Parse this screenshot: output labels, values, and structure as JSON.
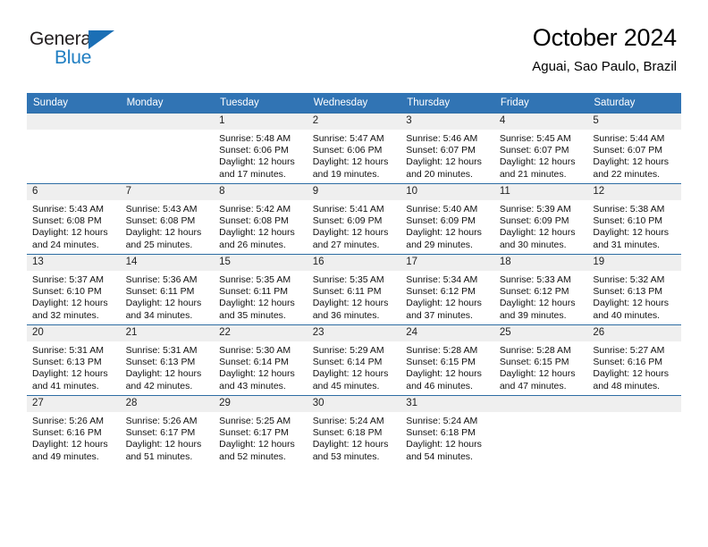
{
  "brand": {
    "name_part1": "General",
    "name_part2": "Blue",
    "flag_icon": "triangle-flag-icon"
  },
  "header": {
    "title": "October 2024",
    "subtitle": "Aguai, Sao Paulo, Brazil"
  },
  "colors": {
    "header_blue": "#3174b4",
    "row_border": "#2e6da4",
    "daynum_bg": "#efefef",
    "brand_blue": "#1f7ec2"
  },
  "weekday_headers": [
    "Sunday",
    "Monday",
    "Tuesday",
    "Wednesday",
    "Thursday",
    "Friday",
    "Saturday"
  ],
  "weeks": [
    [
      {
        "day": "",
        "lines": []
      },
      {
        "day": "",
        "lines": []
      },
      {
        "day": "1",
        "lines": [
          "Sunrise: 5:48 AM",
          "Sunset: 6:06 PM",
          "Daylight: 12 hours",
          "and 17 minutes."
        ]
      },
      {
        "day": "2",
        "lines": [
          "Sunrise: 5:47 AM",
          "Sunset: 6:06 PM",
          "Daylight: 12 hours",
          "and 19 minutes."
        ]
      },
      {
        "day": "3",
        "lines": [
          "Sunrise: 5:46 AM",
          "Sunset: 6:07 PM",
          "Daylight: 12 hours",
          "and 20 minutes."
        ]
      },
      {
        "day": "4",
        "lines": [
          "Sunrise: 5:45 AM",
          "Sunset: 6:07 PM",
          "Daylight: 12 hours",
          "and 21 minutes."
        ]
      },
      {
        "day": "5",
        "lines": [
          "Sunrise: 5:44 AM",
          "Sunset: 6:07 PM",
          "Daylight: 12 hours",
          "and 22 minutes."
        ]
      }
    ],
    [
      {
        "day": "6",
        "lines": [
          "Sunrise: 5:43 AM",
          "Sunset: 6:08 PM",
          "Daylight: 12 hours",
          "and 24 minutes."
        ]
      },
      {
        "day": "7",
        "lines": [
          "Sunrise: 5:43 AM",
          "Sunset: 6:08 PM",
          "Daylight: 12 hours",
          "and 25 minutes."
        ]
      },
      {
        "day": "8",
        "lines": [
          "Sunrise: 5:42 AM",
          "Sunset: 6:08 PM",
          "Daylight: 12 hours",
          "and 26 minutes."
        ]
      },
      {
        "day": "9",
        "lines": [
          "Sunrise: 5:41 AM",
          "Sunset: 6:09 PM",
          "Daylight: 12 hours",
          "and 27 minutes."
        ]
      },
      {
        "day": "10",
        "lines": [
          "Sunrise: 5:40 AM",
          "Sunset: 6:09 PM",
          "Daylight: 12 hours",
          "and 29 minutes."
        ]
      },
      {
        "day": "11",
        "lines": [
          "Sunrise: 5:39 AM",
          "Sunset: 6:09 PM",
          "Daylight: 12 hours",
          "and 30 minutes."
        ]
      },
      {
        "day": "12",
        "lines": [
          "Sunrise: 5:38 AM",
          "Sunset: 6:10 PM",
          "Daylight: 12 hours",
          "and 31 minutes."
        ]
      }
    ],
    [
      {
        "day": "13",
        "lines": [
          "Sunrise: 5:37 AM",
          "Sunset: 6:10 PM",
          "Daylight: 12 hours",
          "and 32 minutes."
        ]
      },
      {
        "day": "14",
        "lines": [
          "Sunrise: 5:36 AM",
          "Sunset: 6:11 PM",
          "Daylight: 12 hours",
          "and 34 minutes."
        ]
      },
      {
        "day": "15",
        "lines": [
          "Sunrise: 5:35 AM",
          "Sunset: 6:11 PM",
          "Daylight: 12 hours",
          "and 35 minutes."
        ]
      },
      {
        "day": "16",
        "lines": [
          "Sunrise: 5:35 AM",
          "Sunset: 6:11 PM",
          "Daylight: 12 hours",
          "and 36 minutes."
        ]
      },
      {
        "day": "17",
        "lines": [
          "Sunrise: 5:34 AM",
          "Sunset: 6:12 PM",
          "Daylight: 12 hours",
          "and 37 minutes."
        ]
      },
      {
        "day": "18",
        "lines": [
          "Sunrise: 5:33 AM",
          "Sunset: 6:12 PM",
          "Daylight: 12 hours",
          "and 39 minutes."
        ]
      },
      {
        "day": "19",
        "lines": [
          "Sunrise: 5:32 AM",
          "Sunset: 6:13 PM",
          "Daylight: 12 hours",
          "and 40 minutes."
        ]
      }
    ],
    [
      {
        "day": "20",
        "lines": [
          "Sunrise: 5:31 AM",
          "Sunset: 6:13 PM",
          "Daylight: 12 hours",
          "and 41 minutes."
        ]
      },
      {
        "day": "21",
        "lines": [
          "Sunrise: 5:31 AM",
          "Sunset: 6:13 PM",
          "Daylight: 12 hours",
          "and 42 minutes."
        ]
      },
      {
        "day": "22",
        "lines": [
          "Sunrise: 5:30 AM",
          "Sunset: 6:14 PM",
          "Daylight: 12 hours",
          "and 43 minutes."
        ]
      },
      {
        "day": "23",
        "lines": [
          "Sunrise: 5:29 AM",
          "Sunset: 6:14 PM",
          "Daylight: 12 hours",
          "and 45 minutes."
        ]
      },
      {
        "day": "24",
        "lines": [
          "Sunrise: 5:28 AM",
          "Sunset: 6:15 PM",
          "Daylight: 12 hours",
          "and 46 minutes."
        ]
      },
      {
        "day": "25",
        "lines": [
          "Sunrise: 5:28 AM",
          "Sunset: 6:15 PM",
          "Daylight: 12 hours",
          "and 47 minutes."
        ]
      },
      {
        "day": "26",
        "lines": [
          "Sunrise: 5:27 AM",
          "Sunset: 6:16 PM",
          "Daylight: 12 hours",
          "and 48 minutes."
        ]
      }
    ],
    [
      {
        "day": "27",
        "lines": [
          "Sunrise: 5:26 AM",
          "Sunset: 6:16 PM",
          "Daylight: 12 hours",
          "and 49 minutes."
        ]
      },
      {
        "day": "28",
        "lines": [
          "Sunrise: 5:26 AM",
          "Sunset: 6:17 PM",
          "Daylight: 12 hours",
          "and 51 minutes."
        ]
      },
      {
        "day": "29",
        "lines": [
          "Sunrise: 5:25 AM",
          "Sunset: 6:17 PM",
          "Daylight: 12 hours",
          "and 52 minutes."
        ]
      },
      {
        "day": "30",
        "lines": [
          "Sunrise: 5:24 AM",
          "Sunset: 6:18 PM",
          "Daylight: 12 hours",
          "and 53 minutes."
        ]
      },
      {
        "day": "31",
        "lines": [
          "Sunrise: 5:24 AM",
          "Sunset: 6:18 PM",
          "Daylight: 12 hours",
          "and 54 minutes."
        ]
      },
      {
        "day": "",
        "lines": []
      },
      {
        "day": "",
        "lines": []
      }
    ]
  ]
}
